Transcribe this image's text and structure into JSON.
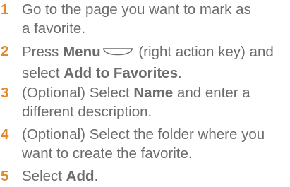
{
  "steps": [
    {
      "num": "1",
      "line1": "Go to the page you want to mark as",
      "line2": "a favorite."
    },
    {
      "num": "2",
      "pre": "Press ",
      "bold1": "Menu",
      "mid": " (right action key) and",
      "line2_pre": "select ",
      "bold2": "Add to Favorites",
      "line2_post": "."
    },
    {
      "num": "3",
      "pre": "(Optional) Select ",
      "bold1": "Name",
      "post": " and enter a",
      "line2": "different description."
    },
    {
      "num": "4",
      "line1": "(Optional) Select the folder where you",
      "line2": "want to create the favorite."
    },
    {
      "num": "5",
      "pre": "Select ",
      "bold1": "Add",
      "post": "."
    }
  ],
  "colors": {
    "step_number": "#e08a2e",
    "text": "#6b6b6b"
  },
  "icons": {
    "menu_key": "right-action-key-icon"
  }
}
